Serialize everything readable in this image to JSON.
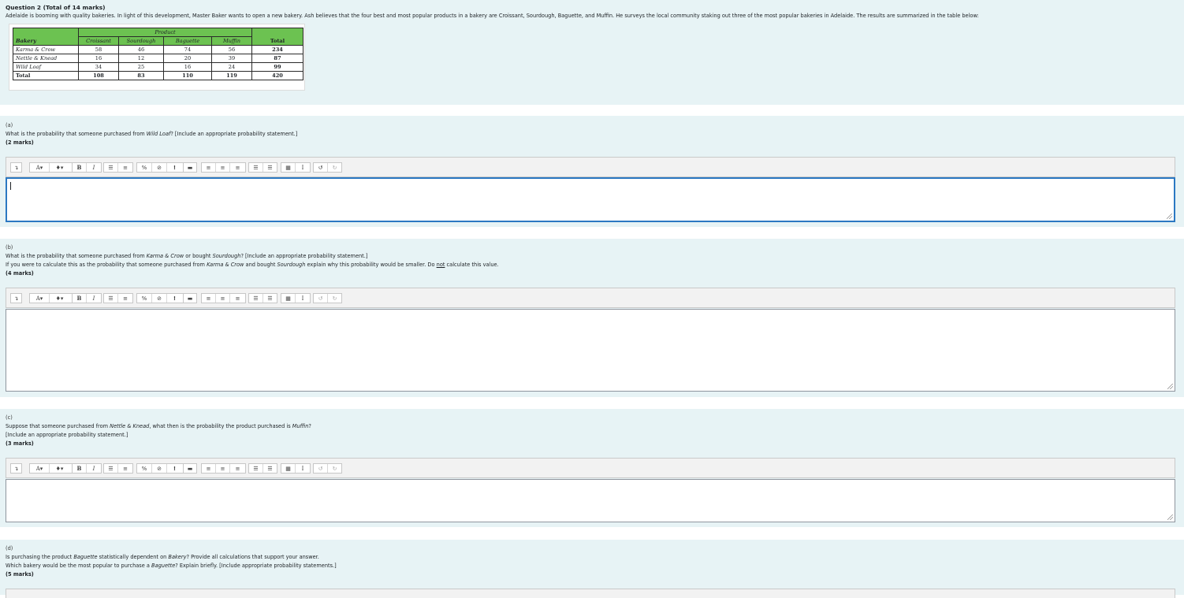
{
  "question": {
    "title": "Question 2 (Total of 14 marks)",
    "intro": "Adelaide is booming with quality bakeries. In light of this development, Master Baker wants to open a new bakery. Ash believes that the four best and most popular products in a bakery are Croissant, Sourdough, Baguette, and Muffin. He surveys the local community staking out three of the most popular bakeries in Adelaide. The results are summarized in the table below:"
  },
  "table": {
    "product_header": "Product",
    "bakery_header": "Bakery",
    "total_header": "Total",
    "columns": [
      "Croissant",
      "Sourdough",
      "Baguette",
      "Muffin"
    ],
    "rows": [
      {
        "name": "Karma & Crow",
        "values": [
          "58",
          "46",
          "74",
          "56"
        ],
        "total": "234"
      },
      {
        "name": "Nettle & Knead",
        "values": [
          "16",
          "12",
          "20",
          "39"
        ],
        "total": "87"
      },
      {
        "name": "Wild Loaf",
        "values": [
          "34",
          "25",
          "16",
          "24"
        ],
        "total": "99"
      }
    ],
    "totals": {
      "label": "Total",
      "values": [
        "108",
        "83",
        "110",
        "119"
      ],
      "grand": "420"
    }
  },
  "parts": {
    "a": {
      "label": "(a)",
      "line1_pre": "What is the probability that someone purchased from ",
      "line1_it": "Wild Loaf",
      "line1_post": "? [Include an appropriate probability statement.]",
      "marks": "(2 marks)"
    },
    "b": {
      "label": "(b)",
      "line1_pre": "What is the probability that someone purchased from ",
      "line1_it1": "Karma & Crow",
      "line1_mid": " or bought ",
      "line1_it2": "Sourdough",
      "line1_post": "? [Include an appropriate probability statement.]",
      "line2_pre": "If you were to calculate this as the probability that someone purchased from ",
      "line2_it1": "Karma & Crow",
      "line2_mid": " and bought ",
      "line2_it2": "Sourdough",
      "line2_post1": " explain why this probability would be smaller. Do ",
      "line2_ul": "not",
      "line2_post2": " calculate this value.",
      "marks": "(4 marks)"
    },
    "c": {
      "label": "(c)",
      "line1_pre": "Suppose that someone purchased from ",
      "line1_it1": "Nettle & Knead",
      "line1_mid": ", what then is the probability the product purchased is ",
      "line1_it2": "Muffin",
      "line1_post": "?",
      "line2": "[Include an appropriate probability statement.]",
      "marks": "(3 marks)"
    },
    "d": {
      "label": "(d)",
      "line1_pre": "Is purchasing the product ",
      "line1_it1": "Baguette",
      "line1_mid": " statistically dependent on ",
      "line1_it2": "Bakery",
      "line1_post": "? Provide all calculations that support your answer.",
      "line2_pre": "Which bakery would be the most popular to purchase a ",
      "line2_it": "Baguette",
      "line2_post": "? Explain briefly. [Include appropriate probability statements.]",
      "marks": "(5 marks)"
    }
  },
  "toolbar": {
    "paragraph": "↴",
    "font_color": "A▾",
    "highlight": "♦▾",
    "bold": "B",
    "italic": "I",
    "bullet_list": "☰",
    "numbered_list": "≡",
    "link": "%",
    "unlink": "⊘",
    "emoji": "!",
    "image": "▬",
    "align_left": "≡",
    "align_center": "≡",
    "align_right": "≡",
    "indent": "☰",
    "outdent": "☰",
    "table": "▦",
    "clear_format": "I",
    "undo": "↺",
    "redo": "↻"
  }
}
